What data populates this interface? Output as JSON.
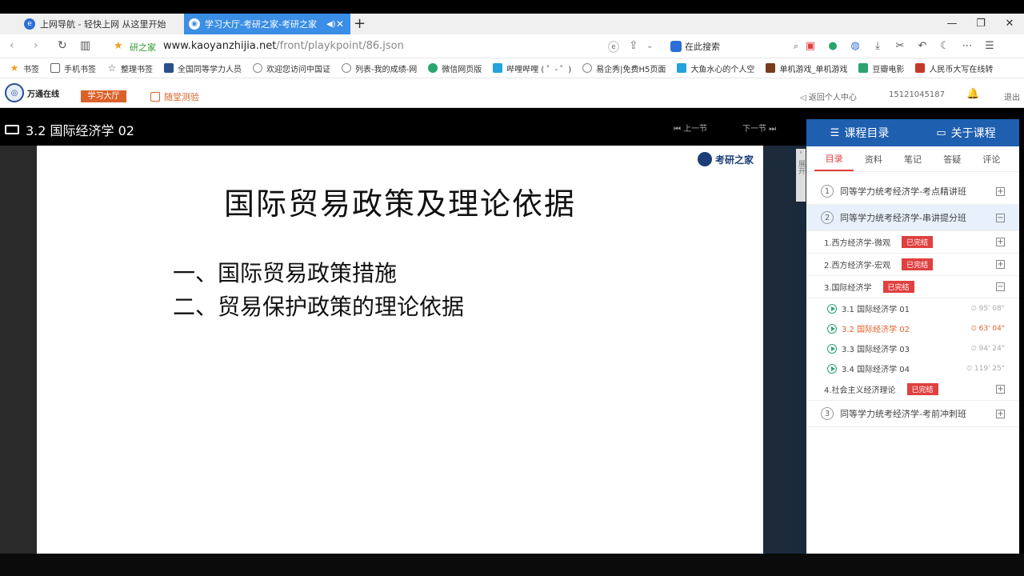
{
  "browser": {
    "tabs": [
      {
        "label": "上网导航 - 轻快上网 从这里开始"
      },
      {
        "label": "学习大厅-考研之家-考研之家"
      }
    ],
    "site_name": "研之家",
    "url_host": "www.kaoyanzhijia.net",
    "url_path": "/front/playkpoint/86.json",
    "search_placeholder": "在此搜索"
  },
  "bookmarks": [
    "书签",
    "手机书签",
    "整理书签",
    "全国同等学力人员",
    "欢迎您访问中国证",
    "列表-我的成绩-网",
    "微信网页版",
    "哔哩哔哩 ( ゜- ゜)",
    "易企秀|免费H5页面",
    "大鱼水心的个人空",
    "单机游戏_单机游戏",
    "豆瓣电影",
    "人民币大写在线转"
  ],
  "site": {
    "logo_text": "万通在线",
    "study_hall": "学习大厅",
    "quiz": "随堂测验",
    "back_center": "返回个人中心",
    "phone": "15121045187",
    "logout": "退出"
  },
  "player": {
    "title": "3.2 国际经济学 02",
    "prev": "上一节",
    "next": "下一节",
    "side_toggle": "展开"
  },
  "slide": {
    "logo": "考研之家",
    "title": "国际贸易政策及理论依据",
    "point1": "一、国际贸易政策措施",
    "point2": "二、贸易保护政策的理论依据"
  },
  "panel": {
    "tab_catalog": "课程目录",
    "tab_about": "关于课程",
    "subtabs": [
      "目录",
      "资料",
      "笔记",
      "答疑",
      "评论"
    ],
    "courses": [
      {
        "num": "1",
        "title": "同等学力统考经济学-考点精讲班"
      },
      {
        "num": "2",
        "title": "同等学力统考经济学-串讲提分班"
      },
      {
        "num": "3",
        "title": "同等学力统考经济学-考前冲刺班"
      }
    ],
    "chapters": [
      {
        "title": "1.西方经济学-微观",
        "badge": "已完结"
      },
      {
        "title": "2.西方经济学-宏观",
        "badge": "已完结"
      },
      {
        "title": "3.国际经济学",
        "badge": "已完结"
      },
      {
        "title": "4.社会主义经济理论",
        "badge": "已完结"
      }
    ],
    "lessons": [
      {
        "title": "3.1 国际经济学 01",
        "dur": "95' 08\""
      },
      {
        "title": "3.2 国际经济学 02",
        "dur": "63' 04\""
      },
      {
        "title": "3.3 国际经济学 03",
        "dur": "94' 24\""
      },
      {
        "title": "3.4 国际经济学 04",
        "dur": "119' 25\""
      }
    ]
  }
}
